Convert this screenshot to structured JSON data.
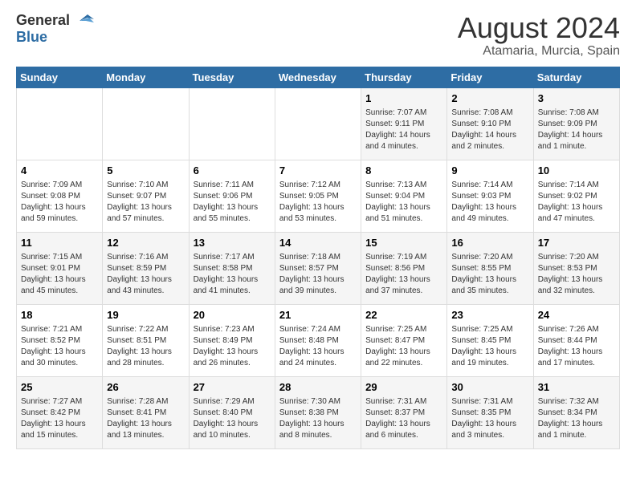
{
  "header": {
    "logo_general": "General",
    "logo_blue": "Blue",
    "title": "August 2024",
    "subtitle": "Atamaria, Murcia, Spain"
  },
  "columns": [
    "Sunday",
    "Monday",
    "Tuesday",
    "Wednesday",
    "Thursday",
    "Friday",
    "Saturday"
  ],
  "weeks": [
    [
      {
        "day": "",
        "detail": ""
      },
      {
        "day": "",
        "detail": ""
      },
      {
        "day": "",
        "detail": ""
      },
      {
        "day": "",
        "detail": ""
      },
      {
        "day": "1",
        "detail": "Sunrise: 7:07 AM\nSunset: 9:11 PM\nDaylight: 14 hours\nand 4 minutes."
      },
      {
        "day": "2",
        "detail": "Sunrise: 7:08 AM\nSunset: 9:10 PM\nDaylight: 14 hours\nand 2 minutes."
      },
      {
        "day": "3",
        "detail": "Sunrise: 7:08 AM\nSunset: 9:09 PM\nDaylight: 14 hours\nand 1 minute."
      }
    ],
    [
      {
        "day": "4",
        "detail": "Sunrise: 7:09 AM\nSunset: 9:08 PM\nDaylight: 13 hours\nand 59 minutes."
      },
      {
        "day": "5",
        "detail": "Sunrise: 7:10 AM\nSunset: 9:07 PM\nDaylight: 13 hours\nand 57 minutes."
      },
      {
        "day": "6",
        "detail": "Sunrise: 7:11 AM\nSunset: 9:06 PM\nDaylight: 13 hours\nand 55 minutes."
      },
      {
        "day": "7",
        "detail": "Sunrise: 7:12 AM\nSunset: 9:05 PM\nDaylight: 13 hours\nand 53 minutes."
      },
      {
        "day": "8",
        "detail": "Sunrise: 7:13 AM\nSunset: 9:04 PM\nDaylight: 13 hours\nand 51 minutes."
      },
      {
        "day": "9",
        "detail": "Sunrise: 7:14 AM\nSunset: 9:03 PM\nDaylight: 13 hours\nand 49 minutes."
      },
      {
        "day": "10",
        "detail": "Sunrise: 7:14 AM\nSunset: 9:02 PM\nDaylight: 13 hours\nand 47 minutes."
      }
    ],
    [
      {
        "day": "11",
        "detail": "Sunrise: 7:15 AM\nSunset: 9:01 PM\nDaylight: 13 hours\nand 45 minutes."
      },
      {
        "day": "12",
        "detail": "Sunrise: 7:16 AM\nSunset: 8:59 PM\nDaylight: 13 hours\nand 43 minutes."
      },
      {
        "day": "13",
        "detail": "Sunrise: 7:17 AM\nSunset: 8:58 PM\nDaylight: 13 hours\nand 41 minutes."
      },
      {
        "day": "14",
        "detail": "Sunrise: 7:18 AM\nSunset: 8:57 PM\nDaylight: 13 hours\nand 39 minutes."
      },
      {
        "day": "15",
        "detail": "Sunrise: 7:19 AM\nSunset: 8:56 PM\nDaylight: 13 hours\nand 37 minutes."
      },
      {
        "day": "16",
        "detail": "Sunrise: 7:20 AM\nSunset: 8:55 PM\nDaylight: 13 hours\nand 35 minutes."
      },
      {
        "day": "17",
        "detail": "Sunrise: 7:20 AM\nSunset: 8:53 PM\nDaylight: 13 hours\nand 32 minutes."
      }
    ],
    [
      {
        "day": "18",
        "detail": "Sunrise: 7:21 AM\nSunset: 8:52 PM\nDaylight: 13 hours\nand 30 minutes."
      },
      {
        "day": "19",
        "detail": "Sunrise: 7:22 AM\nSunset: 8:51 PM\nDaylight: 13 hours\nand 28 minutes."
      },
      {
        "day": "20",
        "detail": "Sunrise: 7:23 AM\nSunset: 8:49 PM\nDaylight: 13 hours\nand 26 minutes."
      },
      {
        "day": "21",
        "detail": "Sunrise: 7:24 AM\nSunset: 8:48 PM\nDaylight: 13 hours\nand 24 minutes."
      },
      {
        "day": "22",
        "detail": "Sunrise: 7:25 AM\nSunset: 8:47 PM\nDaylight: 13 hours\nand 22 minutes."
      },
      {
        "day": "23",
        "detail": "Sunrise: 7:25 AM\nSunset: 8:45 PM\nDaylight: 13 hours\nand 19 minutes."
      },
      {
        "day": "24",
        "detail": "Sunrise: 7:26 AM\nSunset: 8:44 PM\nDaylight: 13 hours\nand 17 minutes."
      }
    ],
    [
      {
        "day": "25",
        "detail": "Sunrise: 7:27 AM\nSunset: 8:42 PM\nDaylight: 13 hours\nand 15 minutes."
      },
      {
        "day": "26",
        "detail": "Sunrise: 7:28 AM\nSunset: 8:41 PM\nDaylight: 13 hours\nand 13 minutes."
      },
      {
        "day": "27",
        "detail": "Sunrise: 7:29 AM\nSunset: 8:40 PM\nDaylight: 13 hours\nand 10 minutes."
      },
      {
        "day": "28",
        "detail": "Sunrise: 7:30 AM\nSunset: 8:38 PM\nDaylight: 13 hours\nand 8 minutes."
      },
      {
        "day": "29",
        "detail": "Sunrise: 7:31 AM\nSunset: 8:37 PM\nDaylight: 13 hours\nand 6 minutes."
      },
      {
        "day": "30",
        "detail": "Sunrise: 7:31 AM\nSunset: 8:35 PM\nDaylight: 13 hours\nand 3 minutes."
      },
      {
        "day": "31",
        "detail": "Sunrise: 7:32 AM\nSunset: 8:34 PM\nDaylight: 13 hours\nand 1 minute."
      }
    ]
  ]
}
